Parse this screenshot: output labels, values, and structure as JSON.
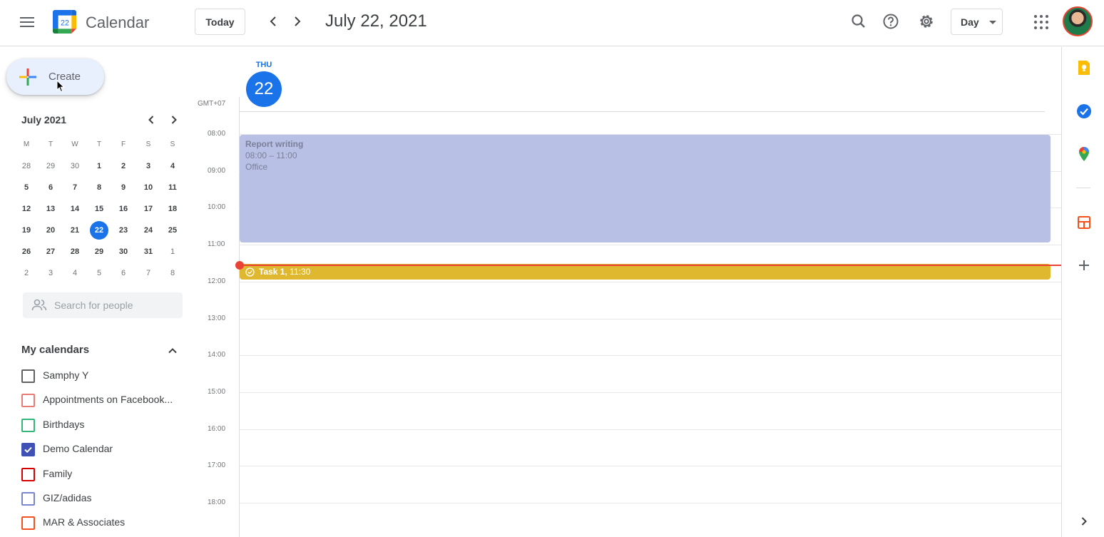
{
  "header": {
    "app_title": "Calendar",
    "logo_day": "22",
    "today_label": "Today",
    "date_title": "July 22, 2021",
    "view_label": "Day"
  },
  "sidebar": {
    "create_label": "Create",
    "mini_calendar": {
      "month_label": "July 2021",
      "weekday_headers": [
        "M",
        "T",
        "W",
        "T",
        "F",
        "S",
        "S"
      ],
      "weeks": [
        [
          "28",
          "29",
          "30",
          "1",
          "2",
          "3",
          "4"
        ],
        [
          "5",
          "6",
          "7",
          "8",
          "9",
          "10",
          "11"
        ],
        [
          "12",
          "13",
          "14",
          "15",
          "16",
          "17",
          "18"
        ],
        [
          "19",
          "20",
          "21",
          "22",
          "23",
          "24",
          "25"
        ],
        [
          "26",
          "27",
          "28",
          "29",
          "30",
          "31",
          "1"
        ],
        [
          "2",
          "3",
          "4",
          "5",
          "6",
          "7",
          "8"
        ]
      ],
      "selected_day": "22"
    },
    "search_people_placeholder": "Search for people",
    "my_calendars_label": "My calendars",
    "calendars": [
      {
        "name": "Samphy Y",
        "color": "#616161",
        "checked": false
      },
      {
        "name": "Appointments on Facebook...",
        "color": "#e67c73",
        "checked": false
      },
      {
        "name": "Birthdays",
        "color": "#33b679",
        "checked": false
      },
      {
        "name": "Demo Calendar",
        "color": "#3f51b5",
        "checked": true
      },
      {
        "name": "Family",
        "color": "#d50000",
        "checked": false
      },
      {
        "name": "GIZ/adidas",
        "color": "#7986cb",
        "checked": false
      },
      {
        "name": "MAR & Associates",
        "color": "#f4511e",
        "checked": false
      }
    ]
  },
  "main": {
    "day_name": "THU",
    "day_number": "22",
    "timezone": "GMT+07",
    "hours": [
      "08:00",
      "09:00",
      "10:00",
      "11:00",
      "12:00",
      "13:00",
      "14:00",
      "15:00",
      "16:00",
      "17:00",
      "18:00"
    ],
    "events": {
      "report": {
        "title": "Report writing",
        "time": "08:00 – 11:00",
        "location": "Office",
        "color": "#b9c0e5"
      },
      "task": {
        "title": "Task 1,",
        "time": "11:30",
        "color": "#e0b830"
      }
    },
    "now_line_color": "#ea4335"
  },
  "side_panel": {
    "icons": [
      "keep-icon",
      "tasks-icon",
      "maps-icon",
      "add-ons-icon",
      "add-icon",
      "expand-panel-icon"
    ]
  }
}
